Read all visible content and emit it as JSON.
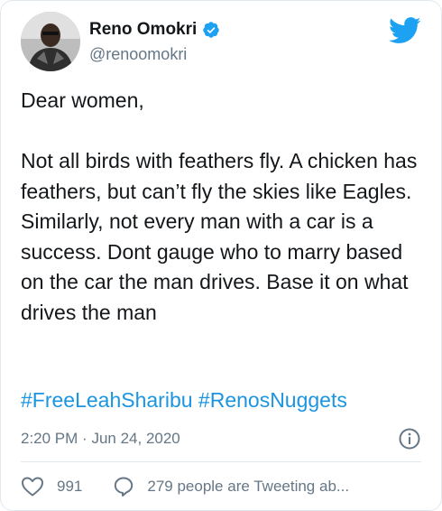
{
  "author": {
    "display_name": "Reno Omokri",
    "handle": "@renoomokri",
    "verified": true,
    "avatar_icon": "profile-photo"
  },
  "tweet": {
    "text": "Dear women,\n\nNot all birds with feathers fly. A chicken has feathers, but can’t fly the skies like Eagles. Similarly, not every man with a car is a success. Dont gauge who to marry based on the car the man drives. Base it on what drives the man",
    "hashtags": [
      "#FreeLeahSharibu",
      "#RenosNuggets"
    ],
    "time": "2:20 PM",
    "separator": "·",
    "date": "Jun 24, 2020"
  },
  "actions": {
    "likes": "991",
    "conversation": "279 people are Tweeting ab..."
  },
  "icons": {
    "brand": "twitter-bird-icon",
    "verified": "verified-badge-icon",
    "info": "info-icon",
    "like": "heart-icon",
    "reply": "speech-bubble-icon"
  },
  "colors": {
    "accent": "#1DA1F2",
    "link": "#1B95E0",
    "secondary_text": "#657786",
    "primary_text": "#14171A"
  }
}
